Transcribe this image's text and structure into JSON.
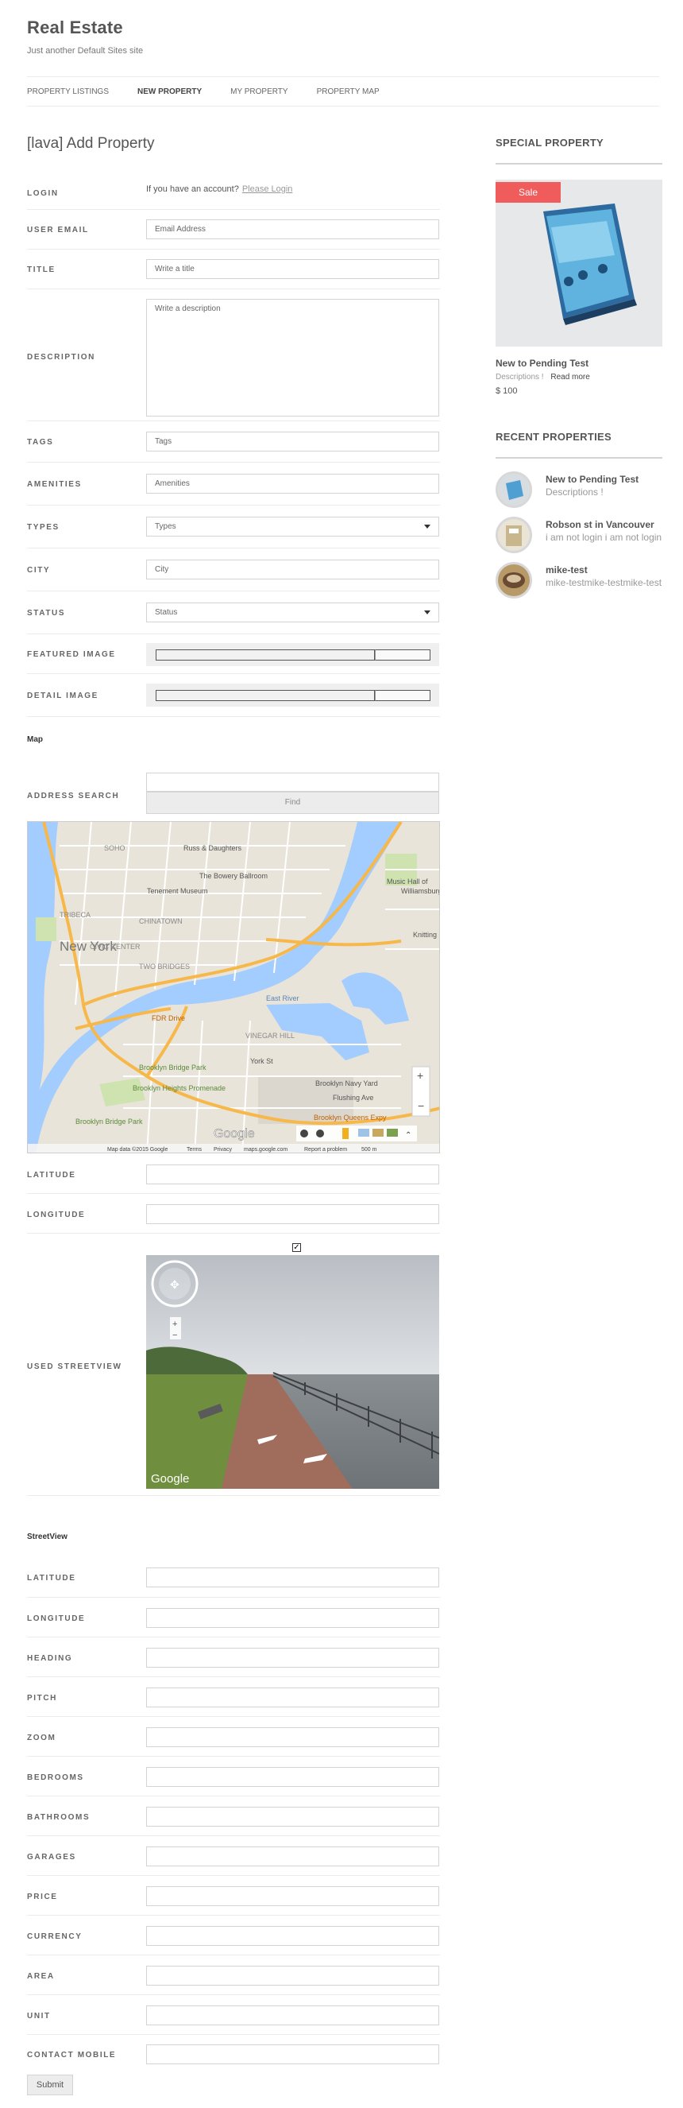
{
  "site": {
    "title": "Real Estate",
    "description": "Just another Default Sites site"
  },
  "nav": {
    "items": [
      {
        "label": "PROPERTY LISTINGS",
        "active": false
      },
      {
        "label": "NEW PROPERTY",
        "active": true
      },
      {
        "label": "MY PROPERTY",
        "active": false
      },
      {
        "label": "PROPERTY MAP",
        "active": false
      }
    ]
  },
  "form": {
    "page_title": "[lava] Add Property",
    "login_label": "LOGIN",
    "login_text": "If you have an account?",
    "login_link": "Please Login",
    "email_label": "USER EMAIL",
    "email_placeholder": "Email Address",
    "title_label": "TITLE",
    "title_placeholder": "Write a title",
    "description_label": "DESCRIPTION",
    "description_placeholder": "Write a description",
    "tags_label": "TAGS",
    "tags_placeholder": "Tags",
    "amenities_label": "AMENITIES",
    "amenities_placeholder": "Amenities",
    "types_label": "TYPES",
    "types_value": "Types",
    "city_label": "CITY",
    "city_placeholder": "City",
    "status_label": "STATUS",
    "status_value": "Status",
    "featured_image_label": "FEATURED IMAGE",
    "detail_image_label": "DETAIL IMAGE",
    "map_section": "Map",
    "address_search_label": "ADDRESS SEARCH",
    "find_button": "Find",
    "latitude_label": "LATITUDE",
    "longitude_label": "LONGITUDE",
    "used_streetview_label": "USED STREETVIEW",
    "used_streetview_checked": true,
    "streetview_section": "StreetView",
    "sv_latitude_label": "LATITUDE",
    "sv_longitude_label": "LONGITUDE",
    "heading_label": "HEADING",
    "pitch_label": "PITCH",
    "zoom_label": "ZOOM",
    "bedrooms_label": "BEDROOMS",
    "bathrooms_label": "BATHROOMS",
    "garages_label": "GARAGES",
    "price_label": "PRICE",
    "currency_label": "CURRENCY",
    "area_label": "AREA",
    "unit_label": "UNIT",
    "contact_mobile_label": "CONTACT MOBILE",
    "submit_button": "Submit"
  },
  "map": {
    "place_labels": [
      "Russ & Daughters",
      "The Bowery Ballroom",
      "Tenement Museum",
      "New York",
      "CHINATOWN",
      "CIVIC CENTER",
      "TWO BRIDGES",
      "TRIBECA",
      "SOHO",
      "East River",
      "Brooklyn Bridge Park",
      "Brooklyn Heights Promenade",
      "VINEGAR HILL",
      "Brooklyn Navy Yard",
      "Brooklyn Bridge Park",
      "Williamsburg",
      "Music Hall of Williamsburg",
      "Brooklyn Queens Expy",
      "Flushing Ave",
      "Knitting F",
      "York St",
      "FDR Drive"
    ],
    "footer": [
      "Map data ©2015 Google",
      "Terms",
      "Privacy",
      "maps.google.com",
      "Report a problem",
      "500 m"
    ],
    "logo": "Google"
  },
  "streetview": {
    "logo": "Google"
  },
  "sidebar": {
    "special_title": "SPECIAL PROPERTY",
    "sale_badge": "Sale",
    "special_name": "New to Pending Test",
    "special_desc": "Descriptions !",
    "special_read_more": "Read more",
    "special_price": "$ 100",
    "recent_title": "RECENT PROPERTIES",
    "recent": [
      {
        "title": "New to Pending Test",
        "desc": "Descriptions !"
      },
      {
        "title": "Robson st in Vancouver",
        "desc": "i am not login i am not login"
      },
      {
        "title": "mike-test",
        "desc": "mike-testmike-testmike-test"
      }
    ]
  },
  "colors": {
    "sale": "#f05b5b",
    "water": "#a3ccff",
    "road": "#f6b84a"
  }
}
